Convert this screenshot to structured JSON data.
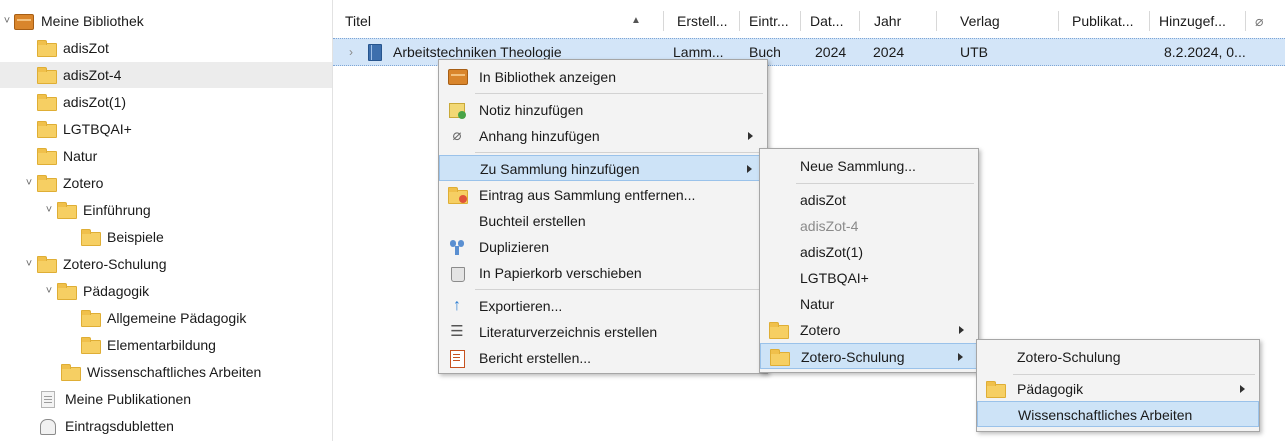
{
  "tree": {
    "items": [
      {
        "label": "Meine Bibliothek",
        "icon": "library-icon",
        "level": 0
      },
      {
        "label": "adisZot",
        "icon": "folder-icon",
        "level": 1
      },
      {
        "label": "adisZot-4",
        "icon": "folder-icon",
        "level": 1,
        "selected": true
      },
      {
        "label": "adisZot(1)",
        "icon": "folder-icon",
        "level": 1
      },
      {
        "label": "LGTBQAI+",
        "icon": "folder-icon",
        "level": 1
      },
      {
        "label": "Natur",
        "icon": "folder-icon",
        "level": 1
      },
      {
        "label": "Zotero",
        "icon": "folder-icon",
        "level": 1,
        "expanded": true
      },
      {
        "label": "Einführung",
        "icon": "folder-icon",
        "level": 2,
        "expanded": true
      },
      {
        "label": "Beispiele",
        "icon": "folder-icon",
        "level": 3
      },
      {
        "label": "Zotero-Schulung",
        "icon": "folder-icon",
        "level": 1,
        "expanded": true
      },
      {
        "label": "Pädagogik",
        "icon": "folder-icon",
        "level": 2,
        "expanded": true
      },
      {
        "label": "Allgemeine Pädagogik",
        "icon": "folder-icon",
        "level": 3
      },
      {
        "label": "Elementarbildung",
        "icon": "folder-icon",
        "level": 3
      },
      {
        "label": "Wissenschaftliches Arbeiten",
        "icon": "folder-icon",
        "level": 2
      },
      {
        "label": "Meine Publikationen",
        "icon": "publications-icon",
        "level": 1
      },
      {
        "label": "Eintragsdubletten",
        "icon": "duplicates-icon",
        "level": 1
      }
    ]
  },
  "table": {
    "columns": [
      "Titel",
      "Erstell...",
      "Eintr...",
      "Dat...",
      "Jahr",
      "Verlag",
      "Publikat...",
      "Hinzugef..."
    ],
    "sort_indicator": "▲",
    "row": {
      "title": "Arbeitstechniken Theologie",
      "creator": "Lamm...",
      "item_type": "Buch",
      "date": "2024",
      "year": "2024",
      "publisher": "UTB",
      "publication": "",
      "date_added": "8.2.2024, 0..."
    }
  },
  "context_menu": {
    "items": [
      {
        "label": "In Bibliothek anzeigen",
        "icon": "library-icon"
      },
      {
        "label": "Notiz hinzufügen",
        "icon": "note-add-icon"
      },
      {
        "label": "Anhang hinzufügen",
        "icon": "paperclip-icon",
        "submenu": true
      },
      {
        "label": "Zu Sammlung hinzufügen",
        "submenu": true,
        "highlighted": true
      },
      {
        "label": "Eintrag aus Sammlung entfernen...",
        "icon": "folder-remove-icon"
      },
      {
        "label": "Buchteil erstellen"
      },
      {
        "label": "Duplizieren",
        "icon": "duplicate-icon"
      },
      {
        "label": "In Papierkorb verschieben",
        "icon": "trash-icon"
      },
      {
        "label": "Exportieren...",
        "icon": "export-icon"
      },
      {
        "label": "Literaturverzeichnis erstellen",
        "icon": "bibliography-icon"
      },
      {
        "label": "Bericht erstellen...",
        "icon": "report-icon"
      }
    ]
  },
  "submenu_collections": {
    "items": [
      {
        "label": "Neue Sammlung..."
      },
      {
        "label": "adisZot"
      },
      {
        "label": "adisZot-4",
        "disabled": true
      },
      {
        "label": "adisZot(1)"
      },
      {
        "label": "LGTBQAI+"
      },
      {
        "label": "Natur"
      },
      {
        "label": "Zotero",
        "icon": "folder-icon",
        "submenu": true
      },
      {
        "label": "Zotero-Schulung",
        "icon": "folder-icon",
        "submenu": true,
        "highlighted": true
      }
    ]
  },
  "submenu_schulung": {
    "items": [
      {
        "label": "Zotero-Schulung"
      },
      {
        "label": "Pädagogik",
        "icon": "folder-icon",
        "submenu": true
      },
      {
        "label": "Wissenschaftliches Arbeiten",
        "highlighted": true
      }
    ]
  }
}
